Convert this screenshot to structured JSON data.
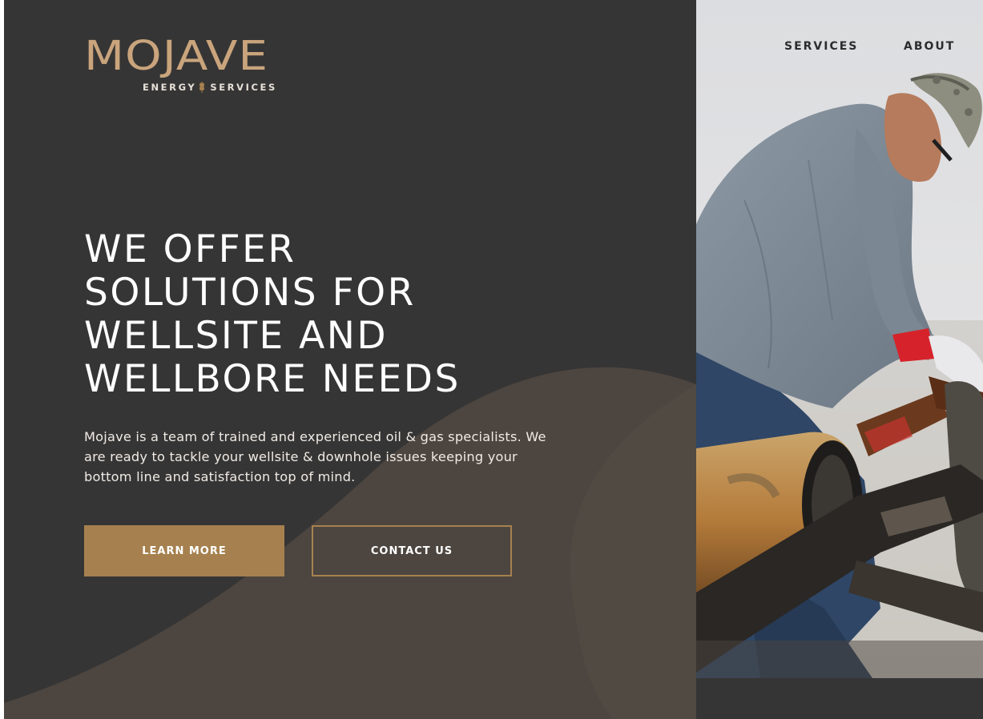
{
  "brand": {
    "name": "MOJAVE",
    "tagline_left": "ENERGY",
    "tagline_right": "SERVICES"
  },
  "nav": {
    "items": [
      {
        "label": "SERVICES"
      },
      {
        "label": "ABOUT"
      }
    ]
  },
  "hero": {
    "headline_lines": [
      "WE OFFER",
      "SOLUTIONS FOR",
      "WELLSITE AND",
      "WELLBORE NEEDS"
    ],
    "intro": "Mojave is a team of trained and experienced oil & gas specialists. We are ready to tackle your wellsite & downhole issues keeping your bottom line and satisfaction top of mind.",
    "primary_button": "LEARN MORE",
    "secondary_button": "CONTACT US"
  },
  "colors": {
    "background_dark": "#363535",
    "wave": "#4d4640",
    "accent_gold": "#a6814f",
    "logo_gold": "#c9a47c",
    "text_light": "#ffffff"
  },
  "icons": {
    "logo_mark": "wheat-stalk-icon"
  }
}
